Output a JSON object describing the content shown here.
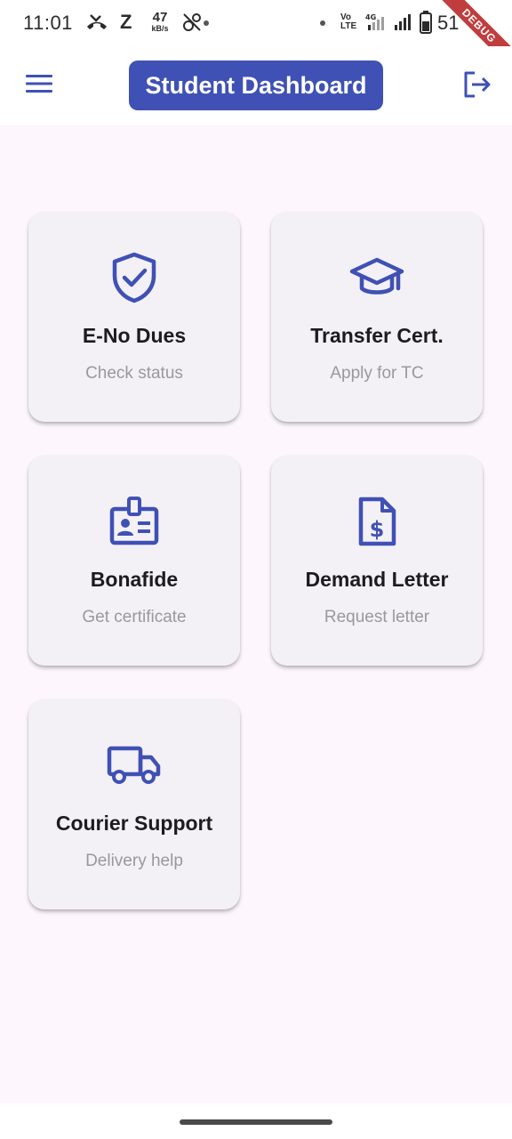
{
  "status_bar": {
    "time": "11:01",
    "z_label": "Z",
    "speed_value": "47",
    "speed_unit": "kB/s",
    "volte_top": "Vo",
    "volte_bottom": "LTE",
    "battery_percent": "51",
    "debug_banner": "DEBUG"
  },
  "app_bar": {
    "title": "Student Dashboard",
    "menu_icon": "hamburger-menu-icon",
    "logout_icon": "logout-icon"
  },
  "cards": [
    {
      "title": "E-No Dues",
      "subtitle": "Check status",
      "icon": "shield-check-icon"
    },
    {
      "title": "Transfer Cert.",
      "subtitle": "Apply for TC",
      "icon": "graduation-cap-icon"
    },
    {
      "title": "Bonafide",
      "subtitle": "Get certificate",
      "icon": "id-badge-icon"
    },
    {
      "title": "Demand Letter",
      "subtitle": "Request letter",
      "icon": "dollar-document-icon"
    },
    {
      "title": "Courier Support",
      "subtitle": "Delivery help",
      "icon": "truck-icon"
    }
  ],
  "colors": {
    "accent": "#3f51b5",
    "background": "#fdf6fd",
    "card": "#f4f1f6",
    "subtitle_text": "#9a979d"
  }
}
